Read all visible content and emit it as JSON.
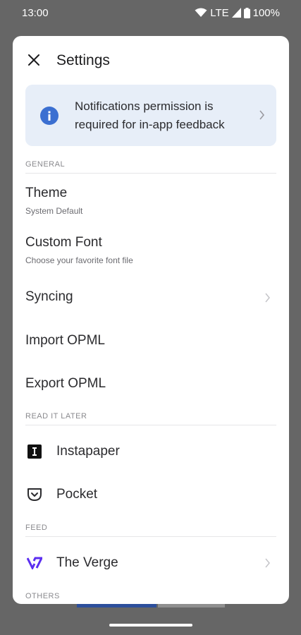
{
  "status_bar": {
    "time": "13:00",
    "network": "LTE",
    "battery": "100%"
  },
  "header": {
    "title": "Settings"
  },
  "banner": {
    "text": "Notifications permission is required for in-app feedback"
  },
  "sections": {
    "general": "GENERAL",
    "read_it_later": "READ IT LATER",
    "feed": "FEED",
    "others": "OTHERS"
  },
  "rows": {
    "theme": {
      "title": "Theme",
      "subtitle": "System Default"
    },
    "custom_font": {
      "title": "Custom Font",
      "subtitle": "Choose your favorite font file"
    },
    "syncing": {
      "title": "Syncing"
    },
    "import_opml": {
      "title": "Import OPML"
    },
    "export_opml": {
      "title": "Export OPML"
    },
    "instapaper": {
      "title": "Instapaper"
    },
    "pocket": {
      "title": "Pocket"
    },
    "the_verge": {
      "title": "The Verge"
    }
  },
  "colors": {
    "accent": "#3b6fd1",
    "banner_bg": "#e7eef8",
    "verge_logo": "#5b2ef0"
  },
  "icons": {
    "close": "close-icon",
    "info": "info-icon",
    "chevron": "chevron-right-icon",
    "instapaper": "instapaper-icon",
    "pocket": "pocket-icon",
    "verge": "verge-logo-icon"
  }
}
